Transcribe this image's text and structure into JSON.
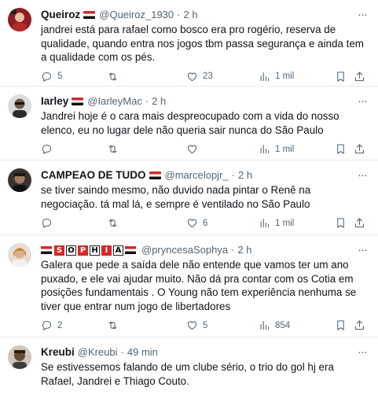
{
  "tweets": [
    {
      "name": "Queiroz",
      "handle": "@Queiroz_1930",
      "time": "2 h",
      "text": "jandrei está para rafael como bosco era pro rogério, reserva de qualidade, quando entra nos jogos tbm passa segurança e ainda tem a qualidade com os pés.",
      "replies": "5",
      "retweets": "",
      "likes": "23",
      "views": "1 mil",
      "avatar_color": "#a22a2a"
    },
    {
      "name": "Iarley",
      "handle": "@IarleyMac",
      "time": "2 h",
      "text": "Jandrei hoje é o cara mais despreocupado com a vida do nosso elenco, eu no lugar dele não queria sair nunca do São Paulo",
      "replies": "",
      "retweets": "",
      "likes": "",
      "views": "1 mil",
      "avatar_color": "#3b3b3b"
    },
    {
      "name": "CAMPEAO DE TUDO",
      "handle": "@marcelopjr_",
      "time": "2 h",
      "text": "se tiver saindo mesmo, não duvido nada pintar o Renê na negociação. tá mal lá, e sempre é ventilado no São Paulo",
      "replies": "",
      "retweets": "",
      "likes": "6",
      "views": "1 mil",
      "avatar_color": "#2e2a28"
    },
    {
      "name_letters": [
        "S",
        "O",
        "P",
        "H",
        "I",
        "A"
      ],
      "handle": "@pryncesaSophya",
      "time": "2 h",
      "text": "Galera que pede a saída dele não entende que vamos ter um ano puxado, e ele vai ajudar muito. Não dá pra contar com os Cotia em posições fundamentais . O Young não tem experiência nenhuma se tiver que entrar num jogo de libertadores",
      "replies": "2",
      "retweets": "",
      "likes": "5",
      "views": "854",
      "avatar_color": "#c9a98c"
    },
    {
      "name": "Kreubi",
      "handle": "@Kreubi",
      "time": "49 min",
      "text": "Se estivessemos falando de um clube sério, o trio do gol hj era Rafael, Jandrei e Thiago Couto.",
      "avatar_color": "#6b4a35"
    }
  ],
  "dot": "·",
  "more_icon": "more-horizontal-icon",
  "colors": {
    "text": "#0f1419",
    "muted": "#536471",
    "divider": "#e6ecf0",
    "flag_red": "#d62828"
  }
}
